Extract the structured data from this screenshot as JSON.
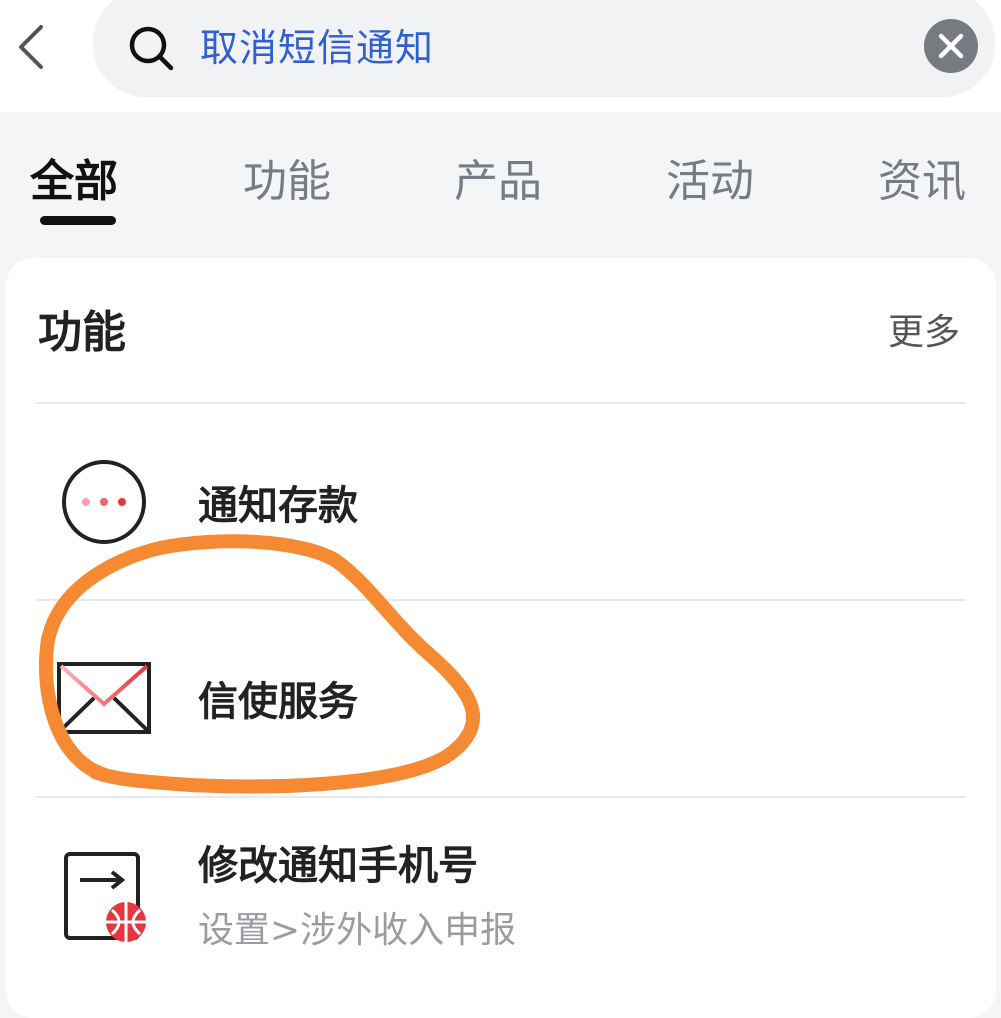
{
  "search": {
    "query": "取消短信通知"
  },
  "tabs": [
    {
      "label": "全部"
    },
    {
      "label": "功能"
    },
    {
      "label": "产品"
    },
    {
      "label": "活动"
    },
    {
      "label": "资讯"
    }
  ],
  "section": {
    "title": "功能",
    "more_label": "更多"
  },
  "items": [
    {
      "label": "通知存款",
      "icon": "dots-circle-icon"
    },
    {
      "label": "信使服务",
      "icon": "envelope-icon"
    },
    {
      "label": "修改通知手机号",
      "subtitle": "设置>涉外收入申报",
      "icon": "phone-transfer-icon"
    }
  ],
  "colors": {
    "accent": "#2f5fd2",
    "highlight_red": "#e8353f",
    "annotation_orange": "#f58a33"
  }
}
